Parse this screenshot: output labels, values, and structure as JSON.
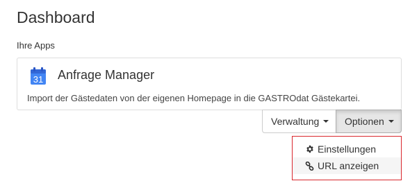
{
  "header": {
    "title": "Dashboard"
  },
  "apps_section": {
    "label": "Ihre Apps"
  },
  "app_card": {
    "icon": "calendar-icon",
    "icon_day": "31",
    "icon_color": "#4285f4",
    "title": "Anfrage Manager",
    "description": "Import der Gästedaten von der eigenen Homepage in die GASTROdat Gästekartei."
  },
  "actions": {
    "manage_label": "Verwaltung",
    "options_label": "Optionen"
  },
  "options_menu": {
    "highlight_color": "#d9262c",
    "items": [
      {
        "label": "Einstellungen",
        "icon": "gear-icon"
      },
      {
        "label": "URL anzeigen",
        "icon": "link-icon"
      }
    ]
  }
}
